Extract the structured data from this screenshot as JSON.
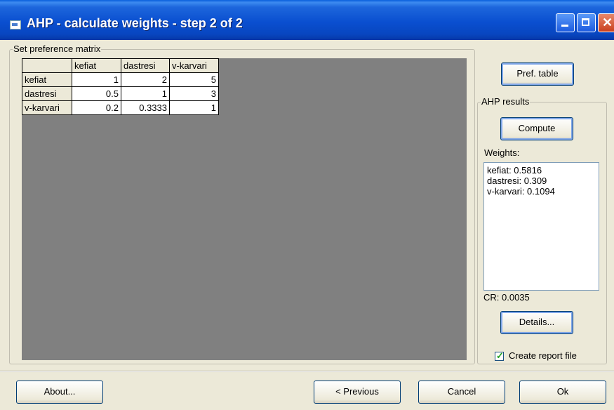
{
  "window": {
    "title": "AHP - calculate weights - step 2 of 2"
  },
  "matrix_group": {
    "legend": "Set preference matrix",
    "columns": [
      "kefiat",
      "dastresi",
      "v-karvari"
    ],
    "rows": [
      {
        "label": "kefiat",
        "values": [
          "1",
          "2",
          "5"
        ]
      },
      {
        "label": "dastresi",
        "values": [
          "0.5",
          "1",
          "3"
        ]
      },
      {
        "label": "v-karvari",
        "values": [
          "0.2",
          "0.3333",
          "1"
        ]
      }
    ]
  },
  "pref_table_button": "Pref. table",
  "ahp_group": {
    "legend": "AHP results",
    "compute_button": "Compute",
    "weights_label": "Weights:",
    "weights": [
      "kefiat: 0.5816",
      "dastresi: 0.309",
      "v-karvari: 0.1094"
    ],
    "cr_label": "CR: 0.0035",
    "details_button": "Details..."
  },
  "report_checkbox": {
    "label": "Create report file",
    "checked": true
  },
  "footer": {
    "about_button": "About...",
    "previous_button": "< Previous",
    "cancel_button": "Cancel",
    "ok_button": "Ok"
  }
}
